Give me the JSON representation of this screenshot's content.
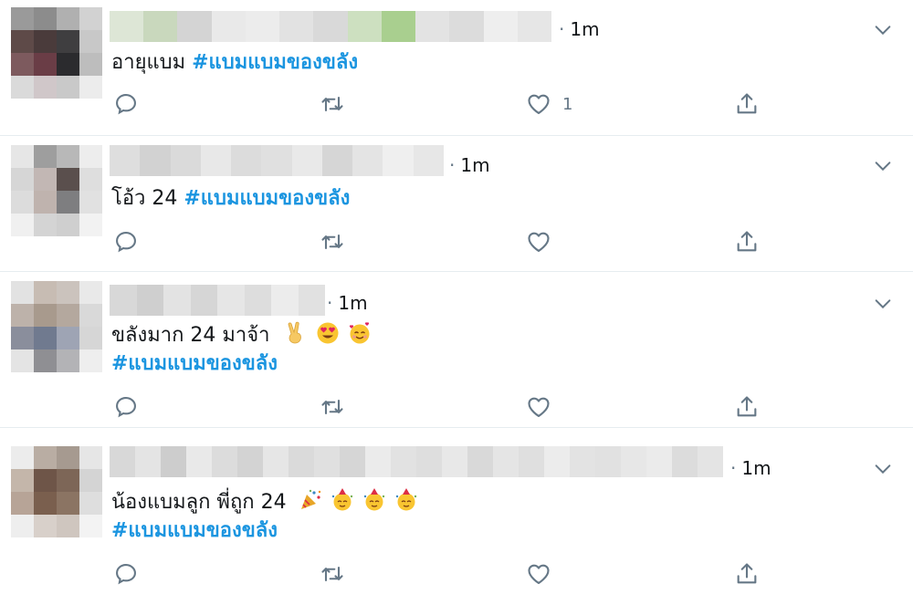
{
  "tweets": [
    {
      "time": "1m",
      "text": "อายุแบม",
      "hashtag": "#แบมแบมของขลัง",
      "text_same_line_hashtag": true,
      "like_count": "1",
      "avatar_colors": [
        "#9a9a9a",
        "#8c8c8c",
        "#b0b0b0",
        "#d2d2d2",
        "#5e4a48",
        "#4a3b3b",
        "#3f3e40",
        "#c8c8c8",
        "#7d5a5e",
        "#6a3d46",
        "#2b2b2e",
        "#bdbdbd",
        "#dadada",
        "#d0c7c9",
        "#c9c9c9",
        "#ececec"
      ],
      "namebar_colors": [
        "#dde6d6",
        "#c9d8bd",
        "#d4d4d4",
        "#e9e9e9",
        "#ececec",
        "#e2e2e2",
        "#d9d9d9",
        "#cde0c0",
        "#a9cf8f",
        "#e3e3e3",
        "#dcdcdc",
        "#eeeeee",
        "#e6e6e6"
      ]
    },
    {
      "time": "1m",
      "text": "โอ้ว 24",
      "hashtag": "#แบมแบมของขลัง",
      "text_same_line_hashtag": true,
      "like_count": "",
      "avatar_colors": [
        "#e6e6e6",
        "#9e9e9e",
        "#b8b8b8",
        "#ededed",
        "#d6d6d6",
        "#c2b7b4",
        "#5a4f4d",
        "#dedede",
        "#dcdcdc",
        "#bfb3ae",
        "#7e7e80",
        "#e1e1e1",
        "#f0f0f0",
        "#d4d4d4",
        "#cfcfcf",
        "#f2f2f2"
      ],
      "namebar_colors": [
        "#dedede",
        "#d2d2d2",
        "#dadada",
        "#e8e8e8",
        "#dcdcdc",
        "#e0e0e0",
        "#e9e9e9",
        "#d6d6d6",
        "#e4e4e4",
        "#efefef",
        "#e7e7e7"
      ]
    },
    {
      "time": "1m",
      "text": "ขลังมาก 24 มาจ้า",
      "hashtag": "#แบมแบมของขลัง",
      "text_same_line_hashtag": false,
      "like_count": "",
      "avatar_colors": [
        "#e2e2e2",
        "#c7bcb3",
        "#cbc3bd",
        "#e9e9e9",
        "#bdb2aa",
        "#a89a8d",
        "#b4a89e",
        "#d9d9d9",
        "#8a8e9c",
        "#707a8f",
        "#9ea4b4",
        "#d6d6d6",
        "#e4e4e4",
        "#8f8f93",
        "#b3b3b6",
        "#eeeeee"
      ],
      "namebar_colors": [
        "#d8d8d8",
        "#cfcfcf",
        "#e3e3e3",
        "#d6d6d6",
        "#e6e6e6",
        "#dddddd",
        "#ececec",
        "#e1e1e1"
      ]
    },
    {
      "time": "1m",
      "text": "น้องแบมลูก พี่ถูก 24",
      "hashtag": "#แบมแบมของขลัง",
      "text_same_line_hashtag": false,
      "like_count": "",
      "avatar_colors": [
        "#ececec",
        "#b9ada3",
        "#a69a90",
        "#e6e6e6",
        "#c4b6aa",
        "#6e5548",
        "#7d6657",
        "#d4d4d4",
        "#b7a497",
        "#7a5f4e",
        "#8b7463",
        "#dedede",
        "#eeeeee",
        "#d8d0ca",
        "#cfc6bf",
        "#f3f3f3"
      ],
      "namebar_colors": [
        "#d8d8d8",
        "#e4e4e4",
        "#cdcdcd",
        "#e9e9e9",
        "#dcdcdc",
        "#d3d3d3",
        "#e6e6e6",
        "#dadada",
        "#e0e0e0",
        "#d6d6d6",
        "#ebebeb",
        "#e2e2e2",
        "#dedede",
        "#e8e8e8",
        "#d9d9d9",
        "#e5e5e5",
        "#dfdfdf",
        "#ececec",
        "#e3e3e3",
        "#e1e1e1",
        "#e7e7e7",
        "#ebebeb",
        "#dcdcdc",
        "#e4e4e4"
      ]
    }
  ],
  "icons": {
    "reply": "reply-icon",
    "retweet": "retweet-icon",
    "like": "heart-icon",
    "share": "share-icon",
    "menu": "chevron-down-icon"
  },
  "colors": {
    "hashtag": "#1b95e0",
    "icon": "#657786",
    "divider": "#e6ecf0"
  }
}
